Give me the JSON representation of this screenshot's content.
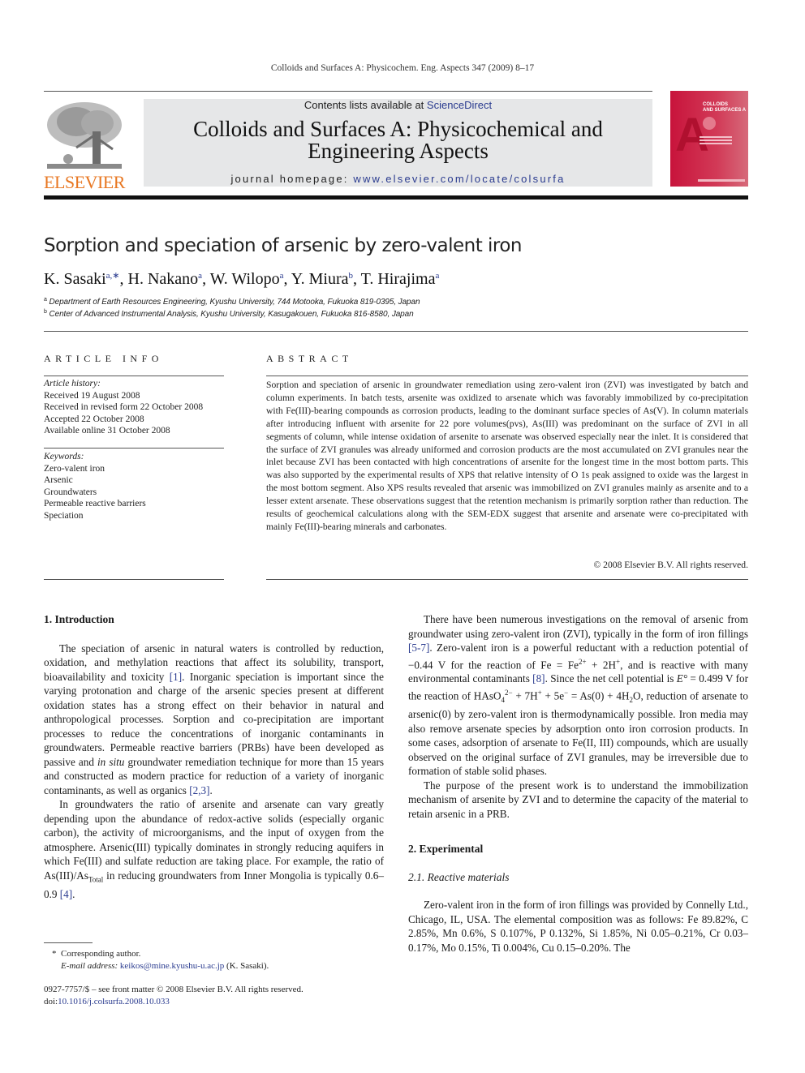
{
  "running_header": "Colloids and Surfaces A: Physicochem. Eng. Aspects 347 (2009) 8–17",
  "masthead": {
    "publisher_logo": "ELSEVIER",
    "contents_prefix": "Contents lists available at ",
    "contents_link": "ScienceDirect",
    "journal_title_line1": "Colloids and Surfaces A: Physicochemical and",
    "journal_title_line2": "Engineering Aspects",
    "homepage_prefix": "journal homepage: ",
    "homepage_link": "www.elsevier.com/locate/colsurfa",
    "cover_title_line1": "COLLOIDS",
    "cover_title_line2": "AND SURFACES A",
    "cover_letter": "A",
    "brand_color": "#e87722",
    "cover_color": "#c8133b",
    "link_color": "#2a3b8f"
  },
  "article": {
    "title": "Sorption and speciation of arsenic by zero-valent iron",
    "authors": [
      {
        "name": "K. Sasaki",
        "sup": "a,∗",
        "sep": ", "
      },
      {
        "name": "H. Nakano",
        "sup": "a",
        "sep": ", "
      },
      {
        "name": "W. Wilopo",
        "sup": "a",
        "sep": ", "
      },
      {
        "name": "Y. Miura",
        "sup": "b",
        "sep": ", "
      },
      {
        "name": "T. Hirajima",
        "sup": "a",
        "sep": ""
      }
    ],
    "affiliations": [
      {
        "mark": "a",
        "text": "Department of Earth Resources Engineering, Kyushu University, 744 Motooka, Fukuoka 819-0395, Japan"
      },
      {
        "mark": "b",
        "text": "Center of Advanced Instrumental Analysis, Kyushu University, Kasugakouen, Fukuoka 816-8580, Japan"
      }
    ]
  },
  "article_info": {
    "heading": "ARTICLE INFO",
    "history_label": "Article history:",
    "history": [
      "Received 19 August 2008",
      "Received in revised form 22 October 2008",
      "Accepted 22 October 2008",
      "Available online 31 October 2008"
    ],
    "keywords_label": "Keywords:",
    "keywords": [
      "Zero-valent iron",
      "Arsenic",
      "Groundwaters",
      "Permeable reactive barriers",
      "Speciation"
    ]
  },
  "abstract": {
    "heading": "ABSTRACT",
    "text": "Sorption and speciation of arsenic in groundwater remediation using zero-valent iron (ZVI) was investigated by batch and column experiments. In batch tests, arsenite was oxidized to arsenate which was favorably immobilized by co-precipitation with Fe(III)-bearing compounds as corrosion products, leading to the dominant surface species of As(V). In column materials after introducing influent with arsenite for 22 pore volumes(pvs), As(III) was predominant on the surface of ZVI in all segments of column, while intense oxidation of arsenite to arsenate was observed especially near the inlet. It is considered that the surface of ZVI granules was already uniformed and corrosion products are the most accumulated on ZVI granules near the inlet because ZVI has been contacted with high concentrations of arsenite for the longest time in the most bottom parts. This was also supported by the experimental results of XPS that relative intensity of O 1s peak assigned to oxide was the largest in the most bottom segment. Also XPS results revealed that arsenic was immobilized on ZVI granules mainly as arsenite and to a lesser extent arsenate. These observations suggest that the retention mechanism is primarily sorption rather than reduction. The results of geochemical calculations along with the SEM-EDX suggest that arsenite and arsenate were co-precipitated with mainly Fe(III)-bearing minerals and carbonates.",
    "copyright": "© 2008 Elsevier B.V. All rights reserved."
  },
  "body": {
    "intro_heading": "1.  Introduction",
    "intro_p1_a": "The speciation of arsenic in natural waters is controlled by reduction, oxidation, and methylation reactions that affect its solubility, transport, bioavailability and toxicity ",
    "intro_p1_ref1": "[1]",
    "intro_p1_b": ". Inorganic speciation is important since the varying protonation and charge of the arsenic species present at different oxidation states has a strong effect on their behavior in natural and anthropological processes. Sorption and co-precipitation are important processes to reduce the concentrations of inorganic contaminants in groundwaters. Permeable reactive barriers (PRBs) have been developed as passive and ",
    "intro_p1_italic": "in situ",
    "intro_p1_c": " groundwater remediation technique for more than 15 years and constructed as modern practice for reduction of a variety of inorganic contaminants, as well as organics ",
    "intro_p1_ref2": "[2,3]",
    "intro_p1_d": ".",
    "intro_p2_a": "In groundwaters the ratio of arsenite and arsenate can vary greatly depending upon the abundance of redox-active solids (especially organic carbon), the activity of microorganisms, and the input of oxygen from the atmosphere. Arsenic(III) typically dominates in strongly reducing aquifers in which Fe(III) and sulfate reduction are taking place. For example, the ratio of As(III)/As",
    "intro_p2_sub": "Total",
    "intro_p2_b": " in reducing groundwaters from Inner Mongolia is typically 0.6–0.9 ",
    "intro_p2_ref": "[4]",
    "intro_p2_c": ".",
    "right_p1_a": "There have been numerous investigations on the removal of arsenic from groundwater using zero-valent iron (ZVI), typically in the form of iron fillings ",
    "right_p1_ref1": "[5-7]",
    "right_p1_b": ". Zero-valent iron is a powerful reductant with a reduction potential of −0.44 V for the reaction of Fe = Fe",
    "right_p1_sup1": "2+",
    "right_p1_c": " + 2H",
    "right_p1_sup2": "+",
    "right_p1_d": ", and is reactive with many environmental contaminants ",
    "right_p1_ref2": "[8]",
    "right_p1_e": ". Since the net cell potential is ",
    "right_p1_E": "E°",
    "right_p1_f": " = 0.499 V for the reaction of HAsO",
    "right_p1_sub1": "4",
    "right_p1_sup3": "2−",
    "right_p1_g": " + 7H",
    "right_p1_sup4": "+",
    "right_p1_h": " + 5e",
    "right_p1_sup5": "−",
    "right_p1_i": " = As(0) + 4H",
    "right_p1_sub2": "2",
    "right_p1_j": "O, reduction of arsenate to arsenic(0) by zero-valent iron is thermodynamically possible. Iron media may also remove arsenate species by adsorption onto iron corrosion products. In some cases, adsorption of arsenate to Fe(II, III) compounds, which are usually observed on the original surface of ZVI granules, may be irreversible due to formation of stable solid phases.",
    "right_p2": "The purpose of the present work is to understand the immobilization mechanism of arsenite by ZVI and to determine the capacity of the material to retain arsenic in a PRB.",
    "exp_heading": "2.  Experimental",
    "exp_sub_heading": "2.1.  Reactive materials",
    "exp_p1": "Zero-valent iron in the form of iron fillings was provided by Connelly Ltd., Chicago, IL, USA. The elemental composition was as follows: Fe 89.82%, C 2.85%, Mn 0.6%, S 0.107%, P 0.132%, Si 1.85%, Ni 0.05–0.21%, Cr 0.03–0.17%, Mo 0.15%, Ti 0.004%, Cu 0.15–0.20%. The"
  },
  "footnotes": {
    "star": "*",
    "corresponding": "Corresponding author.",
    "email_label": "E-mail address: ",
    "email": "keikos@mine.kyushu-u.ac.jp",
    "email_suffix": " (K. Sasaki).",
    "front_matter": "0927-7757/$ – see front matter © 2008 Elsevier B.V. All rights reserved.",
    "doi_label": "doi:",
    "doi": "10.1016/j.colsurfa.2008.10.033"
  }
}
